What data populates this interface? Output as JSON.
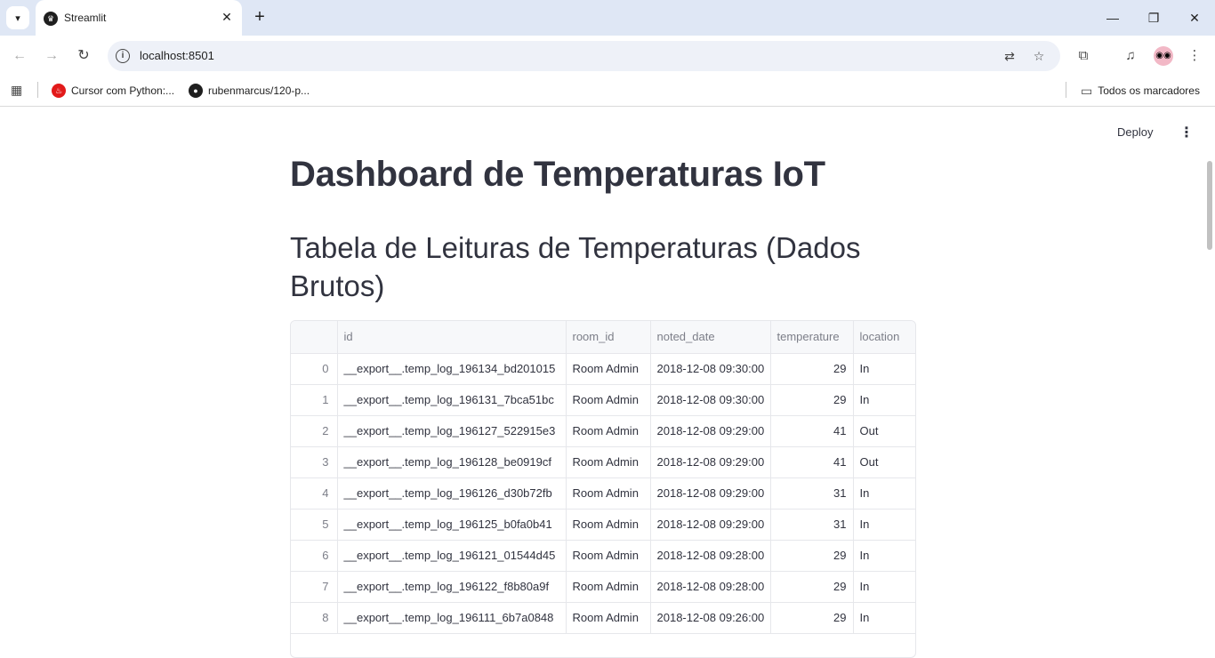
{
  "browser": {
    "tab_title": "Streamlit",
    "url": "localhost:8501",
    "bookmarks": [
      {
        "label": "Cursor com Python:...",
        "icon": "santander-icon"
      },
      {
        "label": "rubenmarcus/120-p...",
        "icon": "github-icon"
      }
    ],
    "all_bookmarks_label": "Todos os marcadores"
  },
  "app": {
    "deploy_label": "Deploy",
    "title": "Dashboard de Temperaturas IoT",
    "subtitle": "Tabela de Leituras de Temperaturas (Dados Brutos)"
  },
  "table": {
    "columns": [
      "",
      "id",
      "room_id",
      "noted_date",
      "temperature",
      "location"
    ],
    "rows": [
      [
        "0",
        "__export__.temp_log_196134_bd201015",
        "Room Admin",
        "2018-12-08 09:30:00",
        "29",
        "In"
      ],
      [
        "1",
        "__export__.temp_log_196131_7bca51bc",
        "Room Admin",
        "2018-12-08 09:30:00",
        "29",
        "In"
      ],
      [
        "2",
        "__export__.temp_log_196127_522915e3",
        "Room Admin",
        "2018-12-08 09:29:00",
        "41",
        "Out"
      ],
      [
        "3",
        "__export__.temp_log_196128_be0919cf",
        "Room Admin",
        "2018-12-08 09:29:00",
        "41",
        "Out"
      ],
      [
        "4",
        "__export__.temp_log_196126_d30b72fb",
        "Room Admin",
        "2018-12-08 09:29:00",
        "31",
        "In"
      ],
      [
        "5",
        "__export__.temp_log_196125_b0fa0b41",
        "Room Admin",
        "2018-12-08 09:29:00",
        "31",
        "In"
      ],
      [
        "6",
        "__export__.temp_log_196121_01544d45",
        "Room Admin",
        "2018-12-08 09:28:00",
        "29",
        "In"
      ],
      [
        "7",
        "__export__.temp_log_196122_f8b80a9f",
        "Room Admin",
        "2018-12-08 09:28:00",
        "29",
        "In"
      ],
      [
        "8",
        "__export__.temp_log_196111_6b7a0848",
        "Room Admin",
        "2018-12-08 09:26:00",
        "29",
        "In"
      ]
    ]
  }
}
